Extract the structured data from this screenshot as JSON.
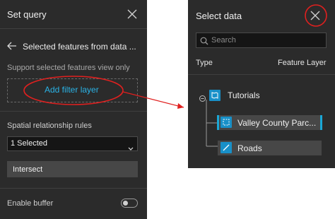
{
  "left_panel": {
    "title": "Set query",
    "back_label": "Selected features from data ...",
    "support_text": "Support selected features view only",
    "add_filter_label": "Add filter layer",
    "spatial_label": "Spatial relationship rules",
    "selected_value": "1 Selected",
    "intersect_value": "Intersect",
    "buffer_label": "Enable buffer",
    "buffer_enabled": false
  },
  "right_panel": {
    "title": "Select data",
    "search_placeholder": "Search",
    "type_label": "Type",
    "type_value": "Feature Layer",
    "tree": {
      "root_label": "Tutorials",
      "children": [
        {
          "label": "Valley County Parc...",
          "selected": true,
          "icon": "polygon-layer-icon"
        },
        {
          "label": "Roads",
          "selected": false,
          "icon": "line-layer-icon"
        }
      ]
    }
  },
  "colors": {
    "panel_bg": "#2b2b2b",
    "accent": "#1aa7d6",
    "annotation_red": "#e0201f"
  }
}
